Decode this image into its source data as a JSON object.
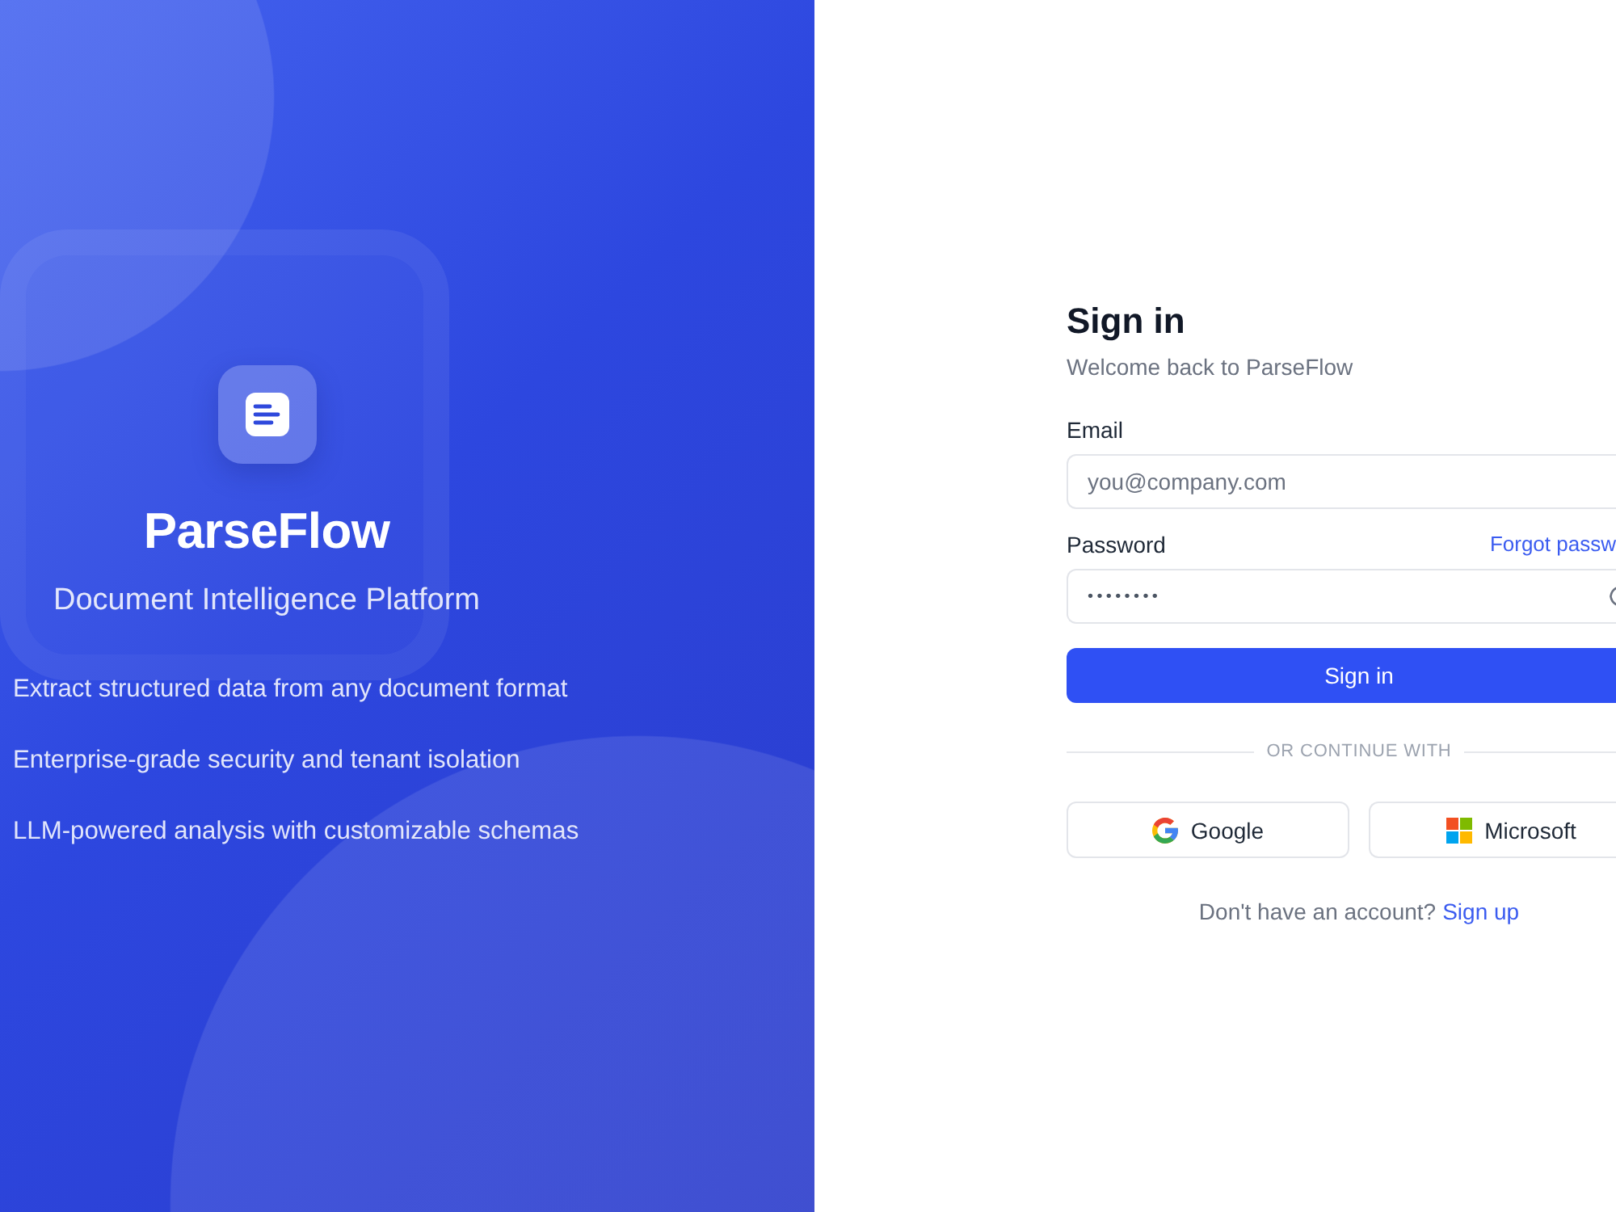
{
  "brand_panel": {
    "app_name": "ParseFlow",
    "tagline": "Document Intelligence Platform",
    "features": [
      "Extract structured data from any document format",
      "Enterprise-grade security and tenant isolation",
      "LLM-powered analysis with customizable schemas"
    ]
  },
  "sign_in_form": {
    "title": "Sign in",
    "subtitle": "Welcome back to ParseFlow",
    "email": {
      "label": "Email",
      "placeholder": "you@company.com"
    },
    "password": {
      "label": "Password",
      "value": "••••••••",
      "forgot_link": "Forgot passw"
    },
    "submit_button": "Sign in",
    "divider": "OR CONTINUE WITH",
    "social_buttons": [
      {
        "kind": "google",
        "label": "Google"
      },
      {
        "kind": "microsoft",
        "label": "Microsoft"
      }
    ],
    "signup_prompt": {
      "text": "Don't have an account?",
      "link": "Sign up"
    }
  }
}
